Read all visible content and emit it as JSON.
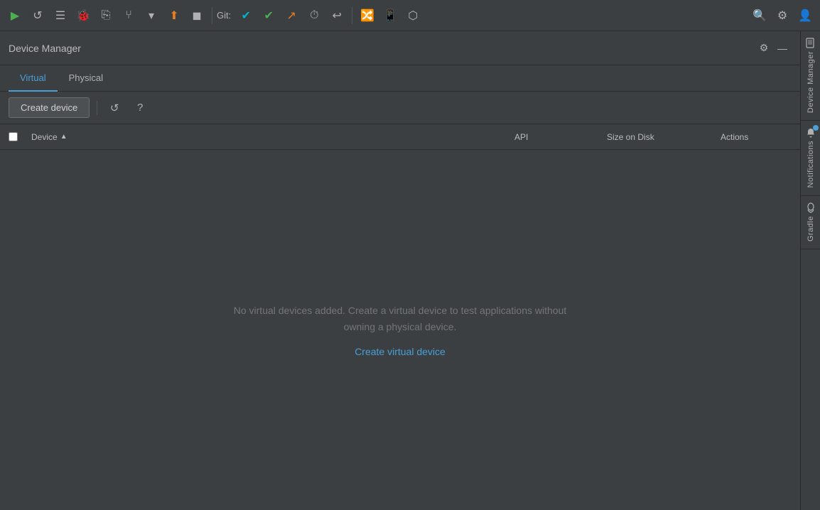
{
  "toolbar": {
    "git_label": "Git:",
    "buttons": [
      {
        "name": "run",
        "icon": "▶",
        "color": "green",
        "label": "Run"
      },
      {
        "name": "reload",
        "icon": "↺",
        "color": "",
        "label": "Reload"
      },
      {
        "name": "list",
        "icon": "≡",
        "color": "",
        "label": "List"
      },
      {
        "name": "bug",
        "icon": "🐞",
        "color": "",
        "label": "Debug"
      },
      {
        "name": "attach",
        "icon": "⎘",
        "color": "",
        "label": "Attach"
      },
      {
        "name": "branch",
        "icon": "⎇",
        "color": "",
        "label": "Branch"
      },
      {
        "name": "dropdown",
        "icon": "▾",
        "color": "",
        "label": "Dropdown"
      },
      {
        "name": "deploy",
        "icon": "⬆",
        "color": "",
        "label": "Deploy"
      },
      {
        "name": "stop",
        "icon": "◼",
        "color": "",
        "label": "Stop"
      }
    ],
    "git_teal": "✔",
    "git_green": "✔",
    "git_arrow": "↗",
    "git_clock": "⏱",
    "git_undo": "↩",
    "search": "🔍",
    "gear": "⚙",
    "profile": "👤"
  },
  "panel": {
    "title": "Device Manager",
    "gear_icon": "⚙",
    "minimize_icon": "—"
  },
  "tabs": [
    {
      "label": "Virtual",
      "active": true
    },
    {
      "label": "Physical",
      "active": false
    }
  ],
  "actions": {
    "create_button": "Create device",
    "refresh_icon": "↺",
    "help_icon": "?"
  },
  "table": {
    "columns": [
      {
        "key": "device",
        "label": "Device"
      },
      {
        "key": "api",
        "label": "API"
      },
      {
        "key": "size_on_disk",
        "label": "Size on Disk"
      },
      {
        "key": "actions",
        "label": "Actions"
      }
    ]
  },
  "empty_state": {
    "message": "No virtual devices added. Create a virtual device to test applications without owning a physical device.",
    "link": "Create virtual device"
  },
  "right_sidebar": [
    {
      "name": "device-manager",
      "icon": "📱",
      "label": "Device Manager",
      "has_dot": false
    },
    {
      "name": "notifications",
      "icon": "🔔",
      "label": "Notifications",
      "has_dot": true
    },
    {
      "name": "gradle",
      "icon": "🐘",
      "label": "Gradle",
      "has_dot": false
    }
  ]
}
